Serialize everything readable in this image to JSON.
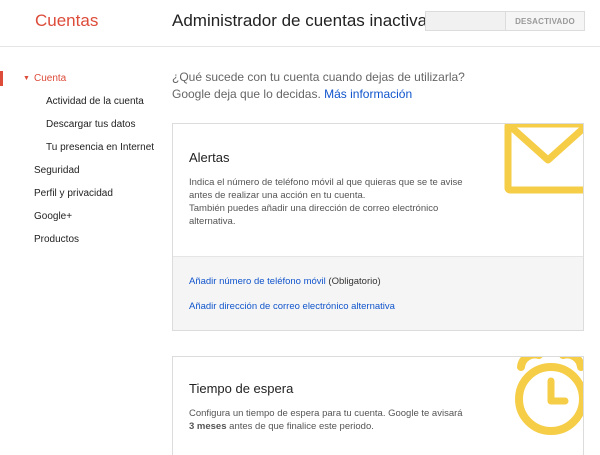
{
  "header": {
    "brand": "Cuentas",
    "title": "Administrador de cuentas inactivas",
    "toggle_label": "DESACTIVADO"
  },
  "nav": {
    "items": [
      {
        "label": "Cuenta",
        "level": 0,
        "active": true
      },
      {
        "label": "Actividad de la cuenta",
        "level": 1,
        "active": false
      },
      {
        "label": "Descargar tus datos",
        "level": 1,
        "active": false
      },
      {
        "label": "Tu presencia en Internet",
        "level": 1,
        "active": false
      },
      {
        "label": "Seguridad",
        "level": 0,
        "active": false
      },
      {
        "label": "Perfil y privacidad",
        "level": 0,
        "active": false
      },
      {
        "label": "Google+",
        "level": 0,
        "active": false
      },
      {
        "label": "Productos",
        "level": 0,
        "active": false
      }
    ]
  },
  "intro": {
    "line1": "¿Qué sucede con tu cuenta cuando dejas de utilizarla?",
    "line2": "Google deja que lo decidas.",
    "link": "Más información"
  },
  "alerts": {
    "title": "Alertas",
    "desc1": "Indica el número de teléfono móvil al que quieras que se te avise antes de realizar una acción en tu cuenta.",
    "desc2": "También puedes añadir una dirección de correo electrónico alternativa.",
    "add_phone": "Añadir número de teléfono móvil",
    "required": "(Obligatorio)",
    "add_email": "Añadir dirección de correo electrónico alternativa"
  },
  "timeout": {
    "title": "Tiempo de espera",
    "desc_before": "Configura un tiempo de espera para tu cuenta. Google te avisará ",
    "desc_bold": "3 meses",
    "desc_after": " antes de que finalice este periodo."
  },
  "colors": {
    "accent": "#dd4b39",
    "link": "#1155cc",
    "decoration": "#f5cd47"
  },
  "icons": {
    "nav_arrow": "caret-down-icon",
    "alerts_deco": "envelope-icon",
    "timeout_deco": "alarm-clock-icon"
  }
}
